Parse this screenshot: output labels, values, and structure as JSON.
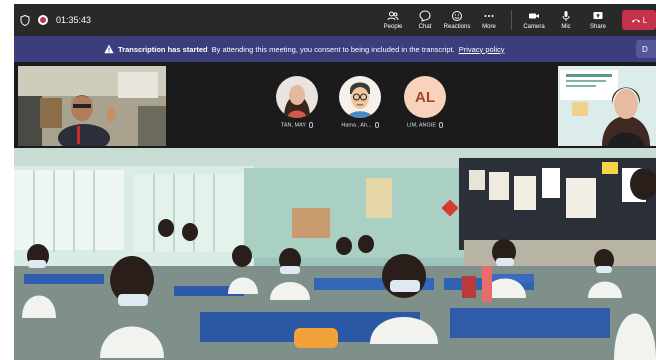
{
  "meeting": {
    "timer": "01:35:43"
  },
  "toolbar": {
    "people": "People",
    "chat": "Chat",
    "reactions": "Reactions",
    "more": "More",
    "camera": "Camera",
    "mic": "Mic",
    "share": "Share",
    "leave": "L"
  },
  "banner": {
    "title": "Transcription has started",
    "message": "By attending this meeting, you consent to being included in the transcript.",
    "link": "Privacy policy",
    "dismiss": "D"
  },
  "participants": [
    {
      "name": "TAN, MAY",
      "muted": true
    },
    {
      "name": "Hama , Ah...",
      "muted": true
    },
    {
      "name": "LIM, ANGIE",
      "initials": "AL",
      "muted": true
    }
  ],
  "colors": {
    "topbar": "#292929",
    "banner": "#3b3d7c",
    "leave": "#c4314b",
    "initials_bg": "#f7d2bd",
    "initials_fg": "#a1452b"
  },
  "icons": [
    "shield-icon",
    "record-icon",
    "people-icon",
    "chat-icon",
    "reactions-icon",
    "more-icon",
    "camera-icon",
    "mic-icon",
    "share-icon",
    "phone-icon",
    "warning-icon"
  ]
}
